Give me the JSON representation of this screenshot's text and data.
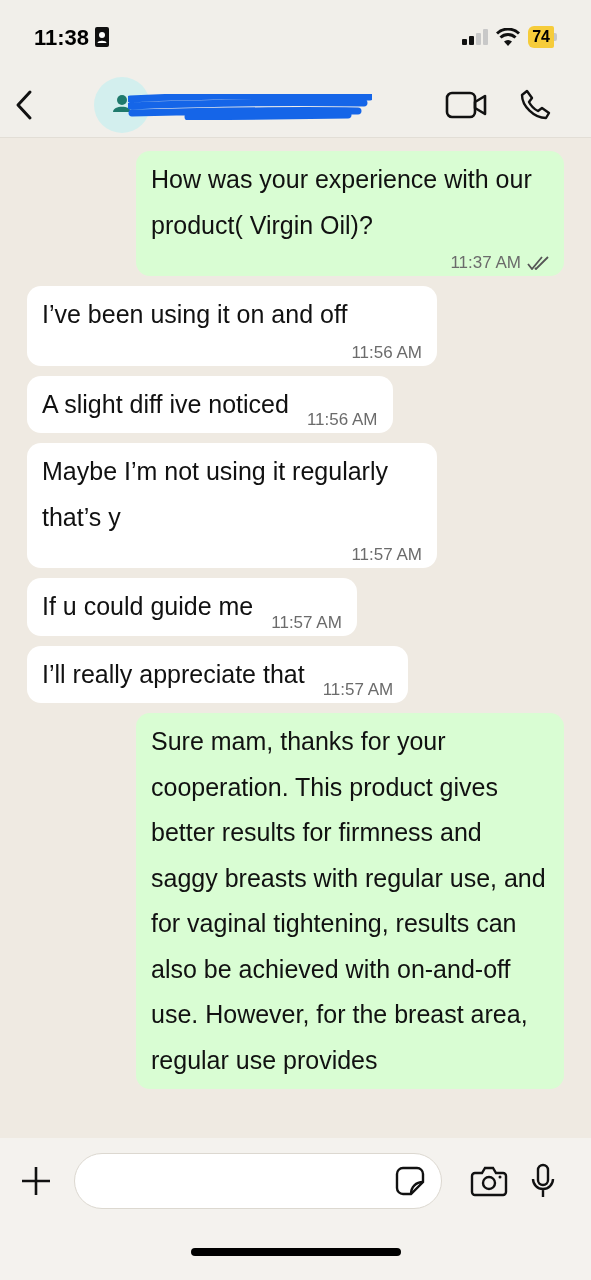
{
  "status_bar": {
    "time": "11:38",
    "battery": "74"
  },
  "messages": [
    {
      "kind": "out",
      "text": "How was your experience with our product( Virgin Oil)?",
      "time": "11:37 AM",
      "read": true
    },
    {
      "kind": "in",
      "text": "I’ve been using it on and off",
      "time": "11:56 AM"
    },
    {
      "kind": "in",
      "text": "A slight diff ive noticed",
      "time": "11:56 AM"
    },
    {
      "kind": "in",
      "text": "Maybe I’m not using it regularly that’s y",
      "time": "11:57 AM"
    },
    {
      "kind": "in",
      "text": "If u could guide me",
      "time": "11:57 AM"
    },
    {
      "kind": "in",
      "text": "I’ll really appreciate that",
      "time": "11:57 AM"
    },
    {
      "kind": "out",
      "text": "Sure mam, thanks for your cooperation. This product gives better results for firmness and saggy breasts with regular use, and for vaginal tightening, results can also be achieved with on-and-off use. However, for the breast area, regular use provides"
    }
  ]
}
